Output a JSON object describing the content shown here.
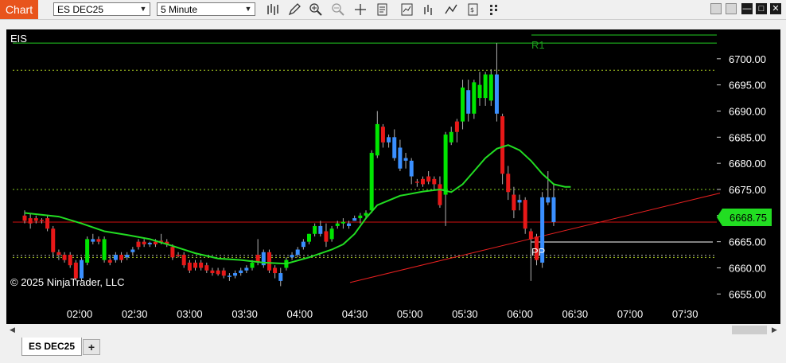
{
  "toolbar": {
    "chart_label": "Chart",
    "instrument": "ES DEC25",
    "interval": "5 Minute",
    "icons": [
      "bars-type-icon",
      "draw-pencil-icon",
      "zoom-in-icon",
      "zoom-out-icon",
      "crosshair-icon",
      "properties-icon",
      "strategies-icon",
      "indicators-icon",
      "drawing-tools-icon",
      "data-box-icon",
      "more-icon"
    ]
  },
  "chart": {
    "series_label": "EIS",
    "copyright": "© 2025 NinjaTrader, LLC",
    "current_price": "6668.75",
    "colors": {
      "up": "#00e600",
      "down": "#e81818",
      "hollow_up": "#3a8fff",
      "ma": "#22dd22",
      "trend": "#e82020",
      "price_badge": "#22dd22"
    },
    "pivot_labels": {
      "r1": "R1",
      "pp": "PP"
    },
    "y_axis": {
      "min": 6652,
      "max": 6705,
      "ticks": [
        "6655.00",
        "6660.00",
        "6665.00",
        "6670.00",
        "6675.00",
        "6680.00",
        "6685.00",
        "6690.00",
        "6695.00",
        "6700.00"
      ]
    },
    "x_axis": {
      "ticks": [
        "02:00",
        "02:30",
        "03:00",
        "03:30",
        "04:00",
        "04:30",
        "05:00",
        "05:30",
        "06:00",
        "06:30",
        "07:00",
        "07:30"
      ]
    }
  },
  "chart_data": {
    "type": "candlestick",
    "candles": [
      {
        "o": 6670.0,
        "h": 6671.0,
        "l": 6668.5,
        "c": 6669.0,
        "k": "down"
      },
      {
        "o": 6669.5,
        "h": 6670.5,
        "l": 6667.5,
        "c": 6668.5,
        "k": "down"
      },
      {
        "o": 6669.5,
        "h": 6670.0,
        "l": 6668.5,
        "c": 6669.0,
        "k": "down"
      },
      {
        "o": 6669.0,
        "h": 6669.5,
        "l": 6668.5,
        "c": 6669.2,
        "k": "down"
      },
      {
        "o": 6669.5,
        "h": 6670.0,
        "l": 6667.0,
        "c": 6667.5,
        "k": "down"
      },
      {
        "o": 6667.5,
        "h": 6668.0,
        "l": 6662.0,
        "c": 6663.0,
        "k": "down"
      },
      {
        "o": 6663.0,
        "h": 6663.5,
        "l": 6661.5,
        "c": 6662.5,
        "k": "down"
      },
      {
        "o": 6662.5,
        "h": 6663.0,
        "l": 6661.0,
        "c": 6661.5,
        "k": "down"
      },
      {
        "o": 6662.5,
        "h": 6663.0,
        "l": 6660.0,
        "c": 6660.5,
        "k": "down"
      },
      {
        "o": 6661.0,
        "h": 6661.5,
        "l": 6657.5,
        "c": 6658.0,
        "k": "down"
      },
      {
        "o": 6658.0,
        "h": 6662.0,
        "l": 6657.5,
        "c": 6661.5,
        "k": "hollow"
      },
      {
        "o": 6661.0,
        "h": 6666.0,
        "l": 6660.5,
        "c": 6665.5,
        "k": "up"
      },
      {
        "o": 6665.5,
        "h": 6666.5,
        "l": 6664.5,
        "c": 6665.0,
        "k": "hollow"
      },
      {
        "o": 6665.5,
        "h": 6666.0,
        "l": 6664.5,
        "c": 6665.0,
        "k": "down"
      },
      {
        "o": 6665.5,
        "h": 6666.0,
        "l": 6661.0,
        "c": 6661.5,
        "k": "up"
      },
      {
        "o": 6661.5,
        "h": 6662.5,
        "l": 6660.5,
        "c": 6661.0,
        "k": "down"
      },
      {
        "o": 6662.5,
        "h": 6663.0,
        "l": 6661.0,
        "c": 6661.5,
        "k": "hollow"
      },
      {
        "o": 6661.5,
        "h": 6663.0,
        "l": 6661.0,
        "c": 6662.5,
        "k": "down"
      },
      {
        "o": 6662.0,
        "h": 6663.0,
        "l": 6661.5,
        "c": 6662.5,
        "k": "hollow"
      },
      {
        "o": 6663.0,
        "h": 6664.0,
        "l": 6662.5,
        "c": 6663.5,
        "k": "hollow"
      },
      {
        "o": 6664.0,
        "h": 6665.5,
        "l": 6663.5,
        "c": 6665.0,
        "k": "down"
      },
      {
        "o": 6665.0,
        "h": 6665.5,
        "l": 6664.0,
        "c": 6664.5,
        "k": "down"
      },
      {
        "o": 6664.5,
        "h": 6665.0,
        "l": 6664.0,
        "c": 6664.8,
        "k": "hollow"
      },
      {
        "o": 6664.5,
        "h": 6665.5,
        "l": 6664.0,
        "c": 6665.0,
        "k": "down"
      },
      {
        "o": 6665.0,
        "h": 6666.5,
        "l": 6664.5,
        "c": 6665.2,
        "k": "down"
      },
      {
        "o": 6665.0,
        "h": 6665.5,
        "l": 6664.0,
        "c": 6664.5,
        "k": "down"
      },
      {
        "o": 6664.0,
        "h": 6664.5,
        "l": 6661.5,
        "c": 6662.0,
        "k": "down"
      },
      {
        "o": 6662.5,
        "h": 6663.0,
        "l": 6662.0,
        "c": 6662.3,
        "k": "down"
      },
      {
        "o": 6662.5,
        "h": 6663.0,
        "l": 6660.0,
        "c": 6660.5,
        "k": "down"
      },
      {
        "o": 6661.0,
        "h": 6661.5,
        "l": 6659.0,
        "c": 6659.5,
        "k": "down"
      },
      {
        "o": 6661.0,
        "h": 6661.5,
        "l": 6659.5,
        "c": 6660.0,
        "k": "down"
      },
      {
        "o": 6661.0,
        "h": 6661.5,
        "l": 6659.5,
        "c": 6660.0,
        "k": "down"
      },
      {
        "o": 6660.5,
        "h": 6661.0,
        "l": 6659.0,
        "c": 6659.5,
        "k": "down"
      },
      {
        "o": 6659.5,
        "h": 6660.0,
        "l": 6658.5,
        "c": 6659.0,
        "k": "down"
      },
      {
        "o": 6659.5,
        "h": 6660.0,
        "l": 6658.5,
        "c": 6658.8,
        "k": "down"
      },
      {
        "o": 6659.5,
        "h": 6660.0,
        "l": 6658.0,
        "c": 6658.5,
        "k": "down"
      },
      {
        "o": 6658.5,
        "h": 6659.0,
        "l": 6657.5,
        "c": 6658.5,
        "k": "hollow"
      },
      {
        "o": 6658.5,
        "h": 6659.5,
        "l": 6658.0,
        "c": 6659.0,
        "k": "hollow"
      },
      {
        "o": 6659.0,
        "h": 6660.0,
        "l": 6658.5,
        "c": 6659.5,
        "k": "hollow"
      },
      {
        "o": 6659.5,
        "h": 6660.5,
        "l": 6659.0,
        "c": 6660.0,
        "k": "hollow"
      },
      {
        "o": 6660.0,
        "h": 6661.5,
        "l": 6659.5,
        "c": 6661.0,
        "k": "up"
      },
      {
        "o": 6661.0,
        "h": 6665.5,
        "l": 6660.5,
        "c": 6662.5,
        "k": "down"
      },
      {
        "o": 6660.5,
        "h": 6663.5,
        "l": 6660.0,
        "c": 6663.0,
        "k": "hollow"
      },
      {
        "o": 6663.0,
        "h": 6663.5,
        "l": 6659.0,
        "c": 6659.5,
        "k": "down"
      },
      {
        "o": 6660.0,
        "h": 6660.5,
        "l": 6658.0,
        "c": 6659.0,
        "k": "down"
      },
      {
        "o": 6659.0,
        "h": 6660.0,
        "l": 6656.5,
        "c": 6657.5,
        "k": "hollow"
      },
      {
        "o": 6660.0,
        "h": 6662.0,
        "l": 6659.5,
        "c": 6661.5,
        "k": "up"
      },
      {
        "o": 6662.0,
        "h": 6663.0,
        "l": 6661.5,
        "c": 6662.5,
        "k": "hollow"
      },
      {
        "o": 6662.5,
        "h": 6664.0,
        "l": 6662.0,
        "c": 6663.5,
        "k": "hollow"
      },
      {
        "o": 6664.0,
        "h": 6665.5,
        "l": 6663.5,
        "c": 6665.0,
        "k": "hollow"
      },
      {
        "o": 6665.0,
        "h": 6666.5,
        "l": 6664.5,
        "c": 6666.5,
        "k": "up"
      },
      {
        "o": 6666.5,
        "h": 6668.5,
        "l": 6666.0,
        "c": 6668.0,
        "k": "up"
      },
      {
        "o": 6668.0,
        "h": 6669.0,
        "l": 6666.0,
        "c": 6666.5,
        "k": "hollow"
      },
      {
        "o": 6667.0,
        "h": 6668.5,
        "l": 6664.0,
        "c": 6665.0,
        "k": "down"
      },
      {
        "o": 6665.5,
        "h": 6668.0,
        "l": 6665.0,
        "c": 6667.5,
        "k": "up"
      },
      {
        "o": 6668.0,
        "h": 6669.0,
        "l": 6667.5,
        "c": 6668.5,
        "k": "up"
      },
      {
        "o": 6668.5,
        "h": 6669.5,
        "l": 6667.5,
        "c": 6668.8,
        "k": "up"
      },
      {
        "o": 6668.5,
        "h": 6669.0,
        "l": 6667.5,
        "c": 6668.0,
        "k": "hollow"
      },
      {
        "o": 6669.5,
        "h": 6670.0,
        "l": 6669.0,
        "c": 6669.0,
        "k": "hollow"
      },
      {
        "o": 6669.5,
        "h": 6670.5,
        "l": 6668.5,
        "c": 6670.0,
        "k": "up"
      },
      {
        "o": 6670.0,
        "h": 6671.0,
        "l": 6669.5,
        "c": 6670.5,
        "k": "up"
      },
      {
        "o": 6671.0,
        "h": 6682.5,
        "l": 6670.5,
        "c": 6682.0,
        "k": "up"
      },
      {
        "o": 6681.5,
        "h": 6690.0,
        "l": 6681.0,
        "c": 6687.5,
        "k": "up"
      },
      {
        "o": 6687.0,
        "h": 6687.5,
        "l": 6683.0,
        "c": 6684.0,
        "k": "down"
      },
      {
        "o": 6684.0,
        "h": 6685.5,
        "l": 6683.0,
        "c": 6685.0,
        "k": "hollow"
      },
      {
        "o": 6685.0,
        "h": 6686.5,
        "l": 6680.5,
        "c": 6681.0,
        "k": "hollow"
      },
      {
        "o": 6683.0,
        "h": 6684.5,
        "l": 6678.5,
        "c": 6679.0,
        "k": "hollow"
      },
      {
        "o": 6681.0,
        "h": 6682.0,
        "l": 6679.0,
        "c": 6680.5,
        "k": "hollow"
      },
      {
        "o": 6680.5,
        "h": 6681.0,
        "l": 6676.0,
        "c": 6677.5,
        "k": "hollow"
      },
      {
        "o": 6676.5,
        "h": 6677.0,
        "l": 6675.5,
        "c": 6676.5,
        "k": "down"
      },
      {
        "o": 6676.0,
        "h": 6677.5,
        "l": 6675.5,
        "c": 6677.0,
        "k": "down"
      },
      {
        "o": 6677.5,
        "h": 6678.5,
        "l": 6676.0,
        "c": 6676.5,
        "k": "down"
      },
      {
        "o": 6677.0,
        "h": 6677.5,
        "l": 6675.0,
        "c": 6676.0,
        "k": "down"
      },
      {
        "o": 6676.0,
        "h": 6677.5,
        "l": 6671.5,
        "c": 6672.0,
        "k": "down"
      },
      {
        "o": 6674.0,
        "h": 6686.0,
        "l": 6668.0,
        "c": 6685.5,
        "k": "up"
      },
      {
        "o": 6684.0,
        "h": 6687.0,
        "l": 6683.5,
        "c": 6686.0,
        "k": "up"
      },
      {
        "o": 6686.0,
        "h": 6688.5,
        "l": 6684.0,
        "c": 6688.0,
        "k": "down"
      },
      {
        "o": 6688.0,
        "h": 6696.0,
        "l": 6686.5,
        "c": 6694.5,
        "k": "up"
      },
      {
        "o": 6694.0,
        "h": 6696.0,
        "l": 6688.0,
        "c": 6689.5,
        "k": "hollow"
      },
      {
        "o": 6689.5,
        "h": 6696.0,
        "l": 6688.5,
        "c": 6695.5,
        "k": "up"
      },
      {
        "o": 6695.0,
        "h": 6697.5,
        "l": 6691.0,
        "c": 6692.5,
        "k": "up"
      },
      {
        "o": 6692.5,
        "h": 6697.5,
        "l": 6691.0,
        "c": 6697.0,
        "k": "up"
      },
      {
        "o": 6697.0,
        "h": 6698.0,
        "l": 6691.0,
        "c": 6692.0,
        "k": "up"
      },
      {
        "o": 6697.0,
        "h": 6703.0,
        "l": 6688.0,
        "c": 6689.5,
        "k": "hollow"
      },
      {
        "o": 6689.0,
        "h": 6689.5,
        "l": 6676.0,
        "c": 6678.0,
        "k": "down"
      },
      {
        "o": 6678.0,
        "h": 6679.5,
        "l": 6673.0,
        "c": 6674.5,
        "k": "down"
      },
      {
        "o": 6674.0,
        "h": 6675.5,
        "l": 6669.5,
        "c": 6671.0,
        "k": "down"
      },
      {
        "o": 6673.0,
        "h": 6674.0,
        "l": 6671.0,
        "c": 6672.5,
        "k": "hollow"
      },
      {
        "o": 6673.0,
        "h": 6673.5,
        "l": 6666.5,
        "c": 6667.5,
        "k": "down"
      },
      {
        "o": 6667.0,
        "h": 6667.5,
        "l": 6657.5,
        "c": 6665.5,
        "k": "down"
      },
      {
        "o": 6666.0,
        "h": 6666.5,
        "l": 6660.5,
        "c": 6661.5,
        "k": "down"
      },
      {
        "o": 6661.0,
        "h": 6674.5,
        "l": 6660.0,
        "c": 6673.5,
        "k": "hollow"
      },
      {
        "o": 6672.5,
        "h": 6678.5,
        "l": 6672.0,
        "c": 6673.5,
        "k": "hollow"
      },
      {
        "o": 6673.5,
        "h": 6676.0,
        "l": 6668.0,
        "c": 6668.75,
        "k": "hollow"
      }
    ],
    "moving_average": [
      [
        0,
        6670.5
      ],
      [
        6,
        6669.8
      ],
      [
        10,
        6668.5
      ],
      [
        14,
        6667.0
      ],
      [
        18,
        6666.3
      ],
      [
        22,
        6665.5
      ],
      [
        26,
        6664.2
      ],
      [
        30,
        6662.8
      ],
      [
        34,
        6661.8
      ],
      [
        38,
        6661.5
      ],
      [
        42,
        6661.0
      ],
      [
        46,
        6660.8
      ],
      [
        50,
        6662.0
      ],
      [
        54,
        6663.5
      ],
      [
        56,
        6664.5
      ],
      [
        58,
        6666.5
      ],
      [
        60,
        6669.5
      ],
      [
        62,
        6672.0
      ],
      [
        66,
        6673.8
      ],
      [
        70,
        6674.6
      ],
      [
        73,
        6675.0
      ],
      [
        75,
        6674.5
      ],
      [
        77,
        6676.0
      ],
      [
        79,
        6678.5
      ],
      [
        81,
        6681.0
      ],
      [
        83,
        6682.8
      ],
      [
        85,
        6683.5
      ],
      [
        87,
        6682.5
      ],
      [
        89,
        6680.5
      ],
      [
        91,
        6678.0
      ],
      [
        93,
        6676.0
      ],
      [
        95,
        6675.5
      ],
      [
        96,
        6675.5
      ]
    ],
    "levels": [
      {
        "price": 6703.0,
        "style": "solid",
        "color": "#22cc22"
      },
      {
        "price": 6697.8,
        "style": "dotted",
        "color": "#aacc22"
      },
      {
        "price": 6675.0,
        "style": "dotted",
        "color": "#88cc22"
      },
      {
        "price": 6668.75,
        "style": "solid",
        "color": "#d01010"
      },
      {
        "price": 6662.4,
        "style": "dotted",
        "color": "#aaaaaa"
      },
      {
        "price": 6662.0,
        "style": "dotted",
        "color": "#aacc22"
      }
    ]
  }
}
